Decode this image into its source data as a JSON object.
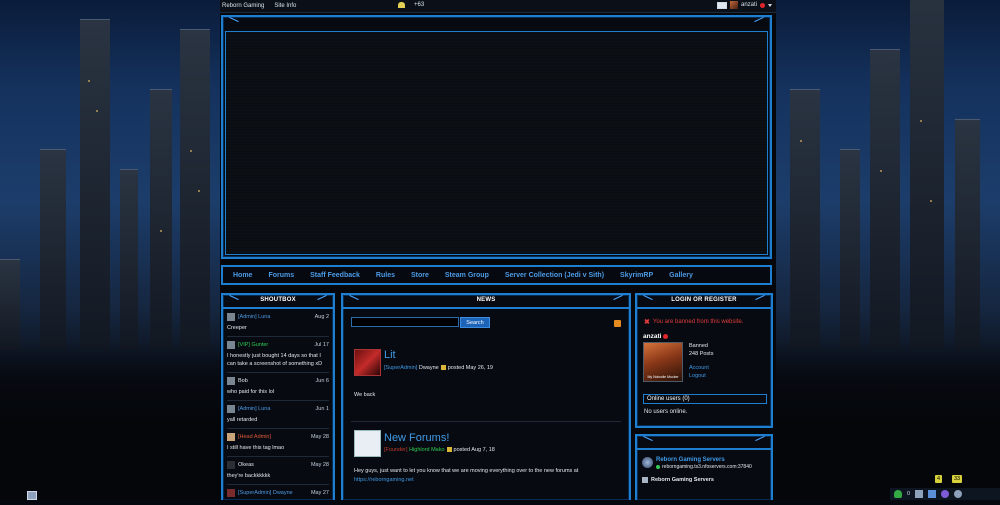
{
  "topbar": {
    "site_name": "Reborn Gaming",
    "site_info": "Site Info",
    "reputation": "+63",
    "username": "anzati"
  },
  "nav": [
    "Home",
    "Forums",
    "Staff Feedback",
    "Rules",
    "Store",
    "Steam Group",
    "Server Collection (Jedi v Sith)",
    "SkyrimRP",
    "Gallery"
  ],
  "shoutbox": {
    "title": "SHOUTBOX",
    "items": [
      {
        "user": "[Admin] Luna",
        "date": "Aug 2",
        "msg": "Creeper",
        "kind": "admin"
      },
      {
        "user": "[VIP] Gunter",
        "date": "Jul 17",
        "msg": "I honestly just bought 14 days so that I can take a screenshot of something xD",
        "kind": "vip"
      },
      {
        "user": "Bob",
        "date": "Jun 6",
        "msg": "who paid for this lol",
        "kind": "plain"
      },
      {
        "user": "[Admin] Luna",
        "date": "Jun 1",
        "msg": "yall retarded",
        "kind": "admin"
      },
      {
        "user": "[Head Admin]",
        "date": "May 28",
        "msg": "I still have this tag lmao",
        "kind": "admin"
      },
      {
        "user": "Okeas",
        "date": "May 28",
        "msg": "they're backkkkkk",
        "kind": "plain"
      },
      {
        "user": "[SuperAdmin] Dwayne",
        "date": "May 27",
        "msg": "",
        "kind": "admin"
      }
    ]
  },
  "news": {
    "title": "NEWS",
    "search_label": "Search",
    "articles": [
      {
        "title": "Lit",
        "role": "[SuperAdmin]",
        "author": "Dwayne",
        "date": "posted May 26, 19",
        "body": "We back"
      },
      {
        "title": "New Forums!",
        "role": "[Founder]",
        "author": "Highlord Mako",
        "date": "posted Aug 7, 18",
        "body": "Hey guys, just want to let you know that we are moving everything over to the new forums at",
        "link": "https://reborngaming.net"
      }
    ]
  },
  "login": {
    "title": "LOGIN OR REGISTER",
    "banned_msg": "You are banned from this website.",
    "username": "anzati",
    "status": "Banned",
    "posts": "248 Posts",
    "account": "Account",
    "logout": "Logout",
    "avatar_caption": "My Nobodie Mocker",
    "online_label": "Online users (0)",
    "no_users": "No users online."
  },
  "servers": {
    "ts_name": "Reborn Gaming Servers",
    "ts_addr": "reborngaming.ts3.nfoservers.com:37840",
    "game_name": "Reborn Gaming Servers"
  },
  "widgets": {
    "badge_left": "4",
    "badge_right": "33",
    "online_count": "0"
  },
  "colors": {
    "frame_blue": "#1e7fd1",
    "link_blue": "#3f9be8",
    "banned_red": "#e13c3c",
    "vip_green": "#33cc55"
  }
}
